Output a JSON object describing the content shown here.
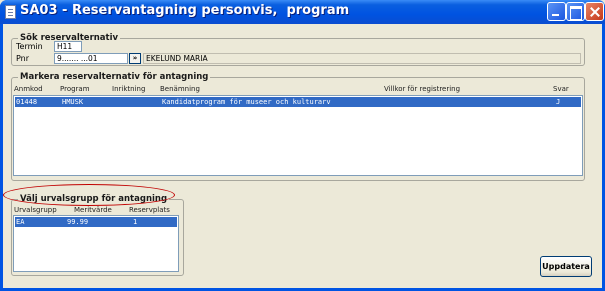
{
  "window": {
    "title": "SA03 - Reservantagning personvis,  program",
    "controls": [
      "minimize-icon",
      "maximize-icon",
      "close-icon"
    ]
  },
  "search": {
    "legend": "Sök reservalternativ",
    "termin_label": "Termin",
    "termin_value": "H11",
    "pnr_label": "Pnr",
    "pnr_value": "9....... ...01",
    "pnr_button": "»",
    "name_value": "EKELUND MARIA"
  },
  "alternatives": {
    "legend": "Markera reservalternativ för antagning",
    "columns": {
      "anmkod": "Anmkod",
      "program": "Program",
      "inriktning": "Inriktning",
      "benamning": "Benämning",
      "villkor": "Villkor för registrering",
      "svar": "Svar"
    },
    "rows": [
      {
        "anmkod": "01448",
        "program": "HMUSK",
        "inriktning": "",
        "benamning": "Kandidatprogram för museer och kulturarv",
        "villkor": "",
        "svar": "J"
      }
    ]
  },
  "groups": {
    "legend": "Välj urvalsgrupp för antagning",
    "columns": {
      "urvalsgrupp": "Urvalsgrupp",
      "meritvarde": "Meritvärde",
      "reservplats": "Reservplats"
    },
    "rows": [
      {
        "urvalsgrupp": "EA",
        "meritvarde": "99.99",
        "reservplats": "1"
      }
    ]
  },
  "actions": {
    "update_label": "Uppdatera"
  },
  "colors": {
    "titlebar": "#0054e3",
    "selection": "#316ac5",
    "annotation": "#c00000"
  }
}
